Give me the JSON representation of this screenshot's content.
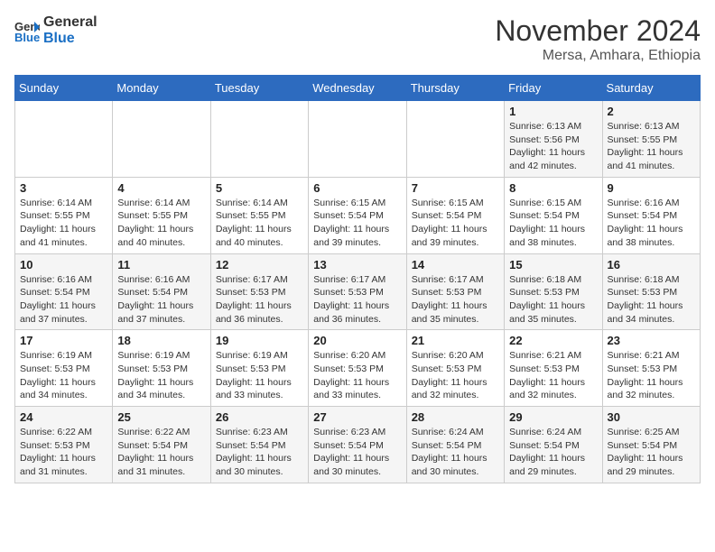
{
  "logo": {
    "line1": "General",
    "line2": "Blue"
  },
  "title": "November 2024",
  "location": "Mersa, Amhara, Ethiopia",
  "days_of_week": [
    "Sunday",
    "Monday",
    "Tuesday",
    "Wednesday",
    "Thursday",
    "Friday",
    "Saturday"
  ],
  "weeks": [
    [
      {
        "num": "",
        "info": ""
      },
      {
        "num": "",
        "info": ""
      },
      {
        "num": "",
        "info": ""
      },
      {
        "num": "",
        "info": ""
      },
      {
        "num": "",
        "info": ""
      },
      {
        "num": "1",
        "info": "Sunrise: 6:13 AM\nSunset: 5:56 PM\nDaylight: 11 hours and 42 minutes."
      },
      {
        "num": "2",
        "info": "Sunrise: 6:13 AM\nSunset: 5:55 PM\nDaylight: 11 hours and 41 minutes."
      }
    ],
    [
      {
        "num": "3",
        "info": "Sunrise: 6:14 AM\nSunset: 5:55 PM\nDaylight: 11 hours and 41 minutes."
      },
      {
        "num": "4",
        "info": "Sunrise: 6:14 AM\nSunset: 5:55 PM\nDaylight: 11 hours and 40 minutes."
      },
      {
        "num": "5",
        "info": "Sunrise: 6:14 AM\nSunset: 5:55 PM\nDaylight: 11 hours and 40 minutes."
      },
      {
        "num": "6",
        "info": "Sunrise: 6:15 AM\nSunset: 5:54 PM\nDaylight: 11 hours and 39 minutes."
      },
      {
        "num": "7",
        "info": "Sunrise: 6:15 AM\nSunset: 5:54 PM\nDaylight: 11 hours and 39 minutes."
      },
      {
        "num": "8",
        "info": "Sunrise: 6:15 AM\nSunset: 5:54 PM\nDaylight: 11 hours and 38 minutes."
      },
      {
        "num": "9",
        "info": "Sunrise: 6:16 AM\nSunset: 5:54 PM\nDaylight: 11 hours and 38 minutes."
      }
    ],
    [
      {
        "num": "10",
        "info": "Sunrise: 6:16 AM\nSunset: 5:54 PM\nDaylight: 11 hours and 37 minutes."
      },
      {
        "num": "11",
        "info": "Sunrise: 6:16 AM\nSunset: 5:54 PM\nDaylight: 11 hours and 37 minutes."
      },
      {
        "num": "12",
        "info": "Sunrise: 6:17 AM\nSunset: 5:53 PM\nDaylight: 11 hours and 36 minutes."
      },
      {
        "num": "13",
        "info": "Sunrise: 6:17 AM\nSunset: 5:53 PM\nDaylight: 11 hours and 36 minutes."
      },
      {
        "num": "14",
        "info": "Sunrise: 6:17 AM\nSunset: 5:53 PM\nDaylight: 11 hours and 35 minutes."
      },
      {
        "num": "15",
        "info": "Sunrise: 6:18 AM\nSunset: 5:53 PM\nDaylight: 11 hours and 35 minutes."
      },
      {
        "num": "16",
        "info": "Sunrise: 6:18 AM\nSunset: 5:53 PM\nDaylight: 11 hours and 34 minutes."
      }
    ],
    [
      {
        "num": "17",
        "info": "Sunrise: 6:19 AM\nSunset: 5:53 PM\nDaylight: 11 hours and 34 minutes."
      },
      {
        "num": "18",
        "info": "Sunrise: 6:19 AM\nSunset: 5:53 PM\nDaylight: 11 hours and 34 minutes."
      },
      {
        "num": "19",
        "info": "Sunrise: 6:19 AM\nSunset: 5:53 PM\nDaylight: 11 hours and 33 minutes."
      },
      {
        "num": "20",
        "info": "Sunrise: 6:20 AM\nSunset: 5:53 PM\nDaylight: 11 hours and 33 minutes."
      },
      {
        "num": "21",
        "info": "Sunrise: 6:20 AM\nSunset: 5:53 PM\nDaylight: 11 hours and 32 minutes."
      },
      {
        "num": "22",
        "info": "Sunrise: 6:21 AM\nSunset: 5:53 PM\nDaylight: 11 hours and 32 minutes."
      },
      {
        "num": "23",
        "info": "Sunrise: 6:21 AM\nSunset: 5:53 PM\nDaylight: 11 hours and 32 minutes."
      }
    ],
    [
      {
        "num": "24",
        "info": "Sunrise: 6:22 AM\nSunset: 5:53 PM\nDaylight: 11 hours and 31 minutes."
      },
      {
        "num": "25",
        "info": "Sunrise: 6:22 AM\nSunset: 5:54 PM\nDaylight: 11 hours and 31 minutes."
      },
      {
        "num": "26",
        "info": "Sunrise: 6:23 AM\nSunset: 5:54 PM\nDaylight: 11 hours and 30 minutes."
      },
      {
        "num": "27",
        "info": "Sunrise: 6:23 AM\nSunset: 5:54 PM\nDaylight: 11 hours and 30 minutes."
      },
      {
        "num": "28",
        "info": "Sunrise: 6:24 AM\nSunset: 5:54 PM\nDaylight: 11 hours and 30 minutes."
      },
      {
        "num": "29",
        "info": "Sunrise: 6:24 AM\nSunset: 5:54 PM\nDaylight: 11 hours and 29 minutes."
      },
      {
        "num": "30",
        "info": "Sunrise: 6:25 AM\nSunset: 5:54 PM\nDaylight: 11 hours and 29 minutes."
      }
    ]
  ]
}
